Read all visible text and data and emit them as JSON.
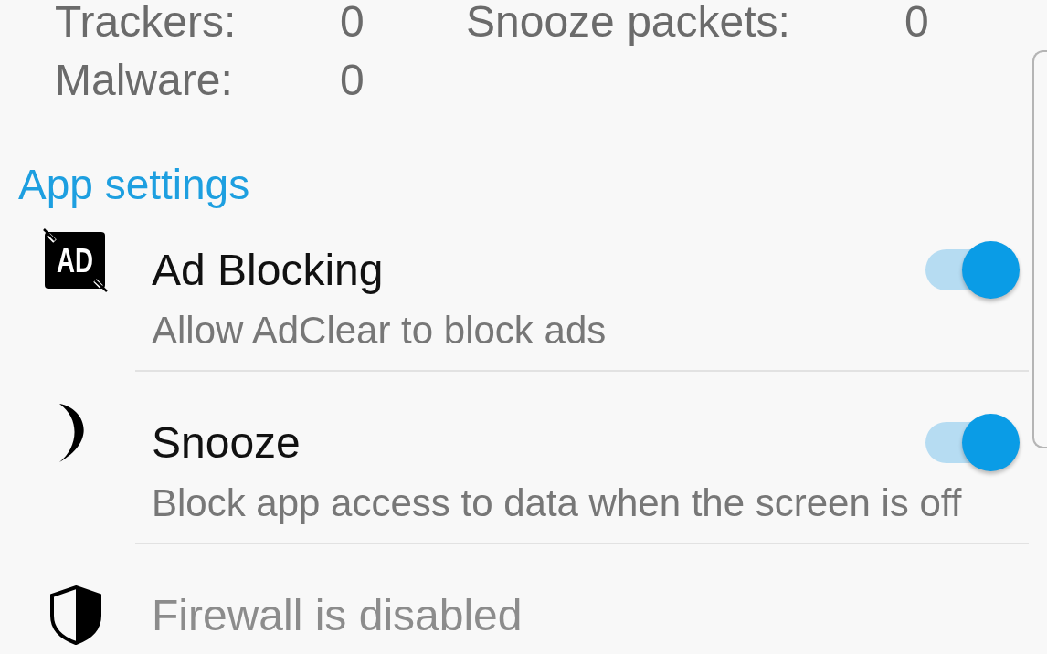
{
  "stats": [
    {
      "label": "Trackers:",
      "value": "0"
    },
    {
      "label": "Snooze packets:",
      "value": "0"
    },
    {
      "label": "Malware:",
      "value": "0"
    }
  ],
  "app_settings": {
    "title": "App settings",
    "items": [
      {
        "kind": "switch",
        "icon_label": "AD",
        "title": "Ad Blocking",
        "subtitle": "Allow AdClear to block ads",
        "on": true,
        "disabled": false
      },
      {
        "kind": "switch",
        "title": "Snooze",
        "subtitle": "Block app access to data when the screen is off",
        "on": true,
        "disabled": false
      },
      {
        "kind": "status",
        "title": "Firewall is disabled",
        "disabled": true
      }
    ]
  }
}
